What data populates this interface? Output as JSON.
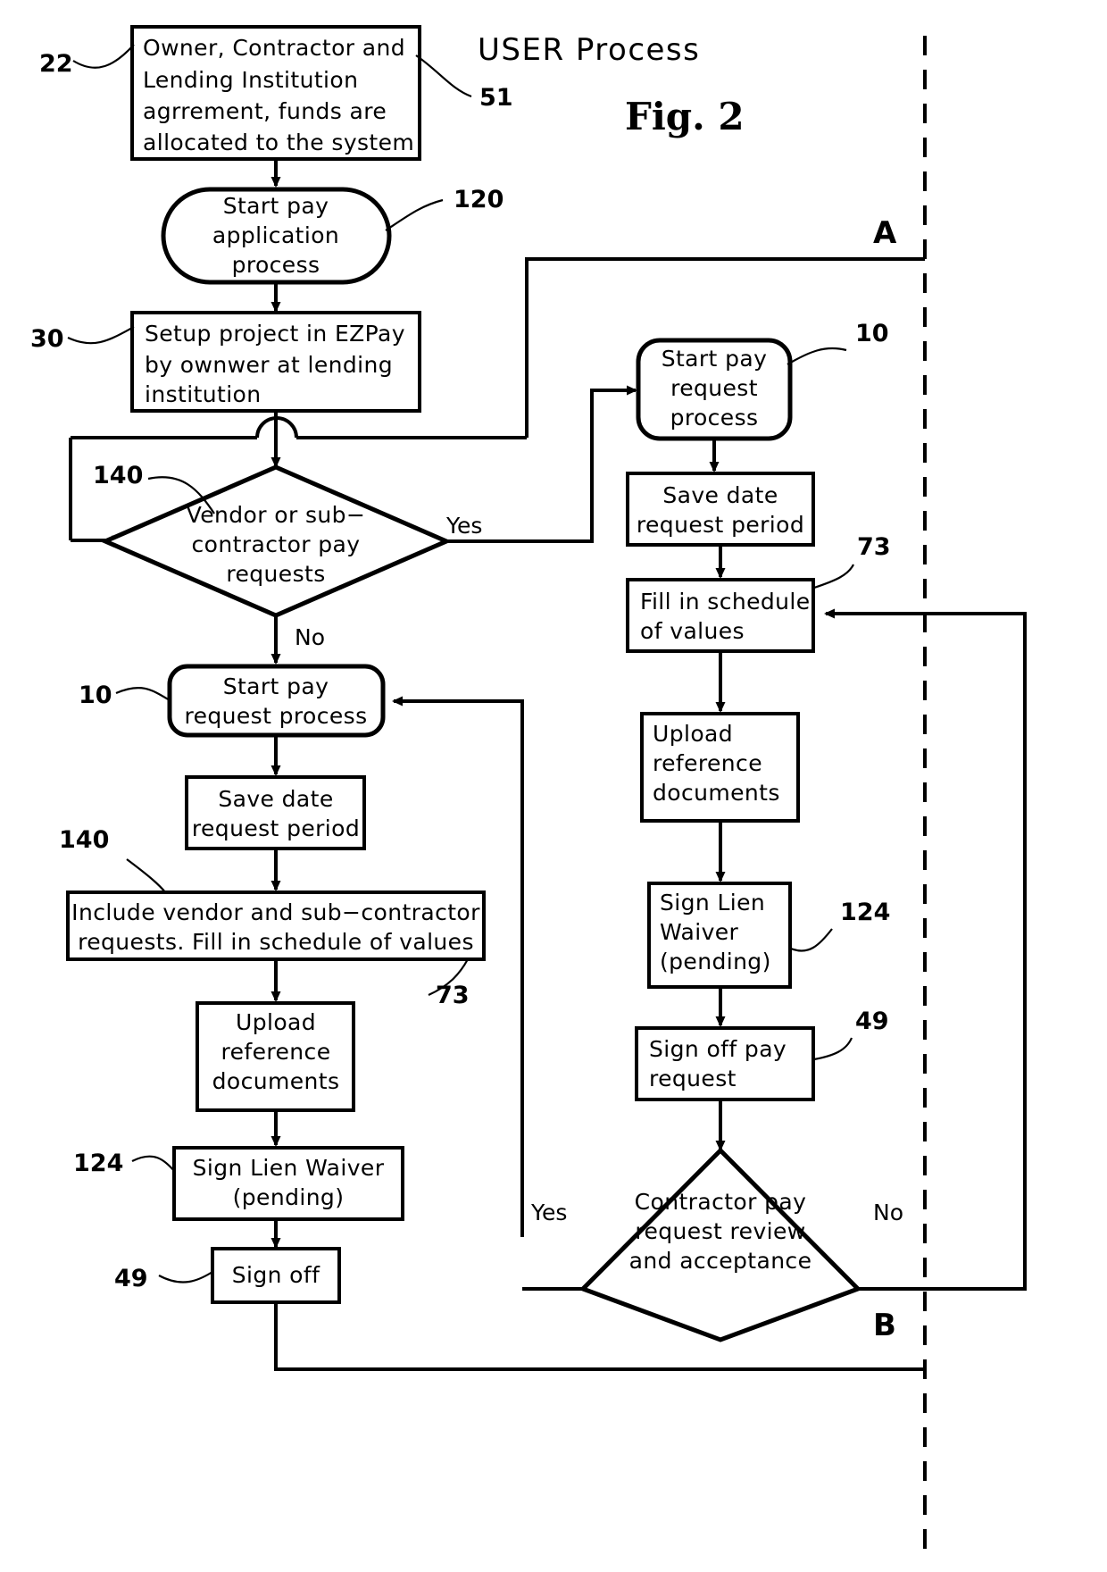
{
  "figure": {
    "title": "USER Process",
    "label": "Fig. 2"
  },
  "connectors": {
    "a": "A",
    "b": "B"
  },
  "branch_labels": {
    "vendor_yes": "Yes",
    "vendor_no": "No",
    "review_yes": "Yes",
    "review_no": "No"
  },
  "nodes": {
    "agreement": {
      "ref": "22",
      "ref2": "51",
      "lines": [
        "Owner, Contractor and",
        "Lending Institution",
        "agrrement, funds are",
        "allocated to the system"
      ]
    },
    "start_pay_application": {
      "ref": "120",
      "lines": [
        "Start pay",
        "application",
        "process"
      ]
    },
    "setup_project": {
      "ref": "30",
      "lines": [
        "Setup project in EZPay",
        "by ownwer at lending",
        "institution"
      ]
    },
    "vendor_decision": {
      "ref": "140",
      "lines": [
        "Vendor or sub−",
        "contractor pay",
        "requests"
      ]
    },
    "left_start_pay_request": {
      "ref": "10",
      "lines": [
        "Start pay",
        "request process"
      ]
    },
    "left_save_date": {
      "lines": [
        "Save date",
        "request period"
      ]
    },
    "left_include_vendor": {
      "ref": "140",
      "ref2": "73",
      "lines": [
        "Include vendor and sub−contractor",
        "requests. Fill in schedule of values"
      ]
    },
    "left_upload_docs": {
      "lines": [
        "Upload",
        "reference",
        "documents"
      ]
    },
    "left_sign_lien": {
      "ref": "124",
      "lines": [
        "Sign Lien Waiver",
        "(pending)"
      ]
    },
    "left_sign_off": {
      "ref": "49",
      "lines": [
        "Sign off"
      ]
    },
    "right_start_pay_request": {
      "ref": "10",
      "lines": [
        "Start pay",
        "request",
        "process"
      ]
    },
    "right_save_date": {
      "lines": [
        "Save date",
        "request period"
      ]
    },
    "right_fill_schedule": {
      "ref": "73",
      "lines": [
        "Fill in schedule",
        "of values"
      ]
    },
    "right_upload_docs": {
      "lines": [
        "Upload",
        "reference",
        "documents"
      ]
    },
    "right_sign_lien": {
      "ref": "124",
      "lines": [
        "Sign Lien",
        "Waiver",
        "(pending)"
      ]
    },
    "right_sign_off_pay": {
      "ref": "49",
      "lines": [
        "Sign off pay",
        "request"
      ]
    },
    "review_decision": {
      "lines": [
        "Contractor pay",
        "request review",
        "and acceptance"
      ]
    }
  },
  "colors": {
    "ink": "#000000",
    "paper": "#ffffff"
  }
}
